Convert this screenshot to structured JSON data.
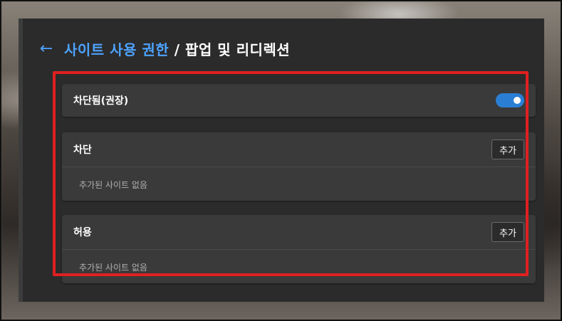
{
  "header": {
    "back_icon": "←",
    "breadcrumb": "사이트 사용 권한",
    "separator": " / ",
    "page_title": "팝업 및 리디렉션"
  },
  "blocked_setting": {
    "label": "차단됨(권장)",
    "enabled": true
  },
  "block_section": {
    "label": "차단",
    "add_label": "추가",
    "empty_text": "추가된 사이트 없음"
  },
  "allow_section": {
    "label": "허용",
    "add_label": "추가",
    "empty_text": "추가된 사이트 없음"
  },
  "colors": {
    "accent": "#4da3ff",
    "toggle_on": "#2a7fd4",
    "highlight": "#e02020",
    "panel_bg": "#2b2b2b",
    "card_bg": "#3a3a3a"
  }
}
